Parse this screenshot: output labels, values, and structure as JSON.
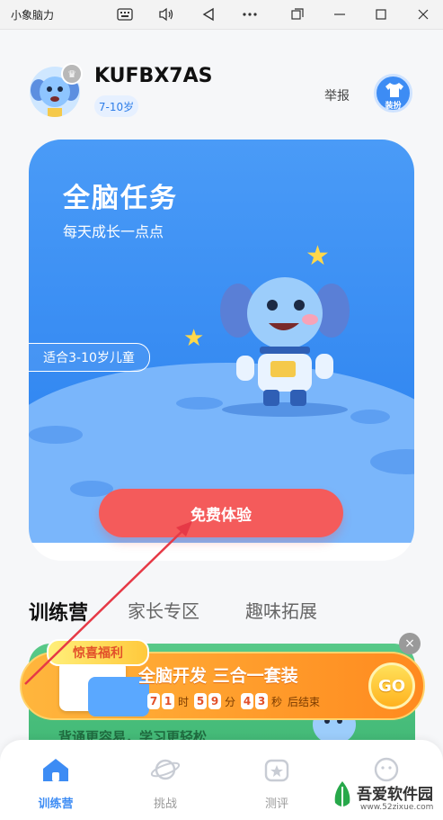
{
  "window": {
    "title": "小象脑力",
    "icons": [
      "keyboard-icon",
      "volume-icon",
      "back-triangle-icon",
      "more-dots-icon",
      "restore-icon",
      "minimize-icon",
      "maximize-icon",
      "close-icon"
    ]
  },
  "profile": {
    "username": "KUFBX7AS",
    "age_range": "7-10岁",
    "report_label": "举报",
    "dress_label": "装扮"
  },
  "banner": {
    "title": "全脑任务",
    "subtitle": "每天成长一点点",
    "age_pill": "适合3-10岁儿童",
    "cta_label": "免费体验",
    "colors": {
      "top": "#3d8cf4",
      "cta": "#f45b5b"
    }
  },
  "tabs": [
    {
      "label": "训练营",
      "active": true
    },
    {
      "label": "家长专区",
      "active": false
    },
    {
      "label": "趣味拓展",
      "active": false
    }
  ],
  "section_card": {
    "text": "背诵更容易，学习更轻松"
  },
  "promo": {
    "tag": "惊喜福利",
    "title": "全脑开发 三合一套装",
    "countdown": {
      "hours": [
        "7",
        "1"
      ],
      "hour_unit": "时",
      "minutes": [
        "5",
        "9"
      ],
      "minute_unit": "分",
      "seconds": [
        "4",
        "3"
      ],
      "second_unit": "秒",
      "suffix": "后结束"
    },
    "go_label": "GO",
    "close_symbol": "×"
  },
  "bottom_nav": [
    {
      "label": "训练营",
      "icon": "home-icon",
      "active": true
    },
    {
      "label": "挑战",
      "icon": "planet-icon",
      "active": false
    },
    {
      "label": "测评",
      "icon": "evaluation-icon",
      "active": false
    },
    {
      "label": "",
      "icon": "profile-icon",
      "active": false
    }
  ],
  "watermark": {
    "name": "吾爱软件园",
    "url": "www.52zixue.com"
  }
}
